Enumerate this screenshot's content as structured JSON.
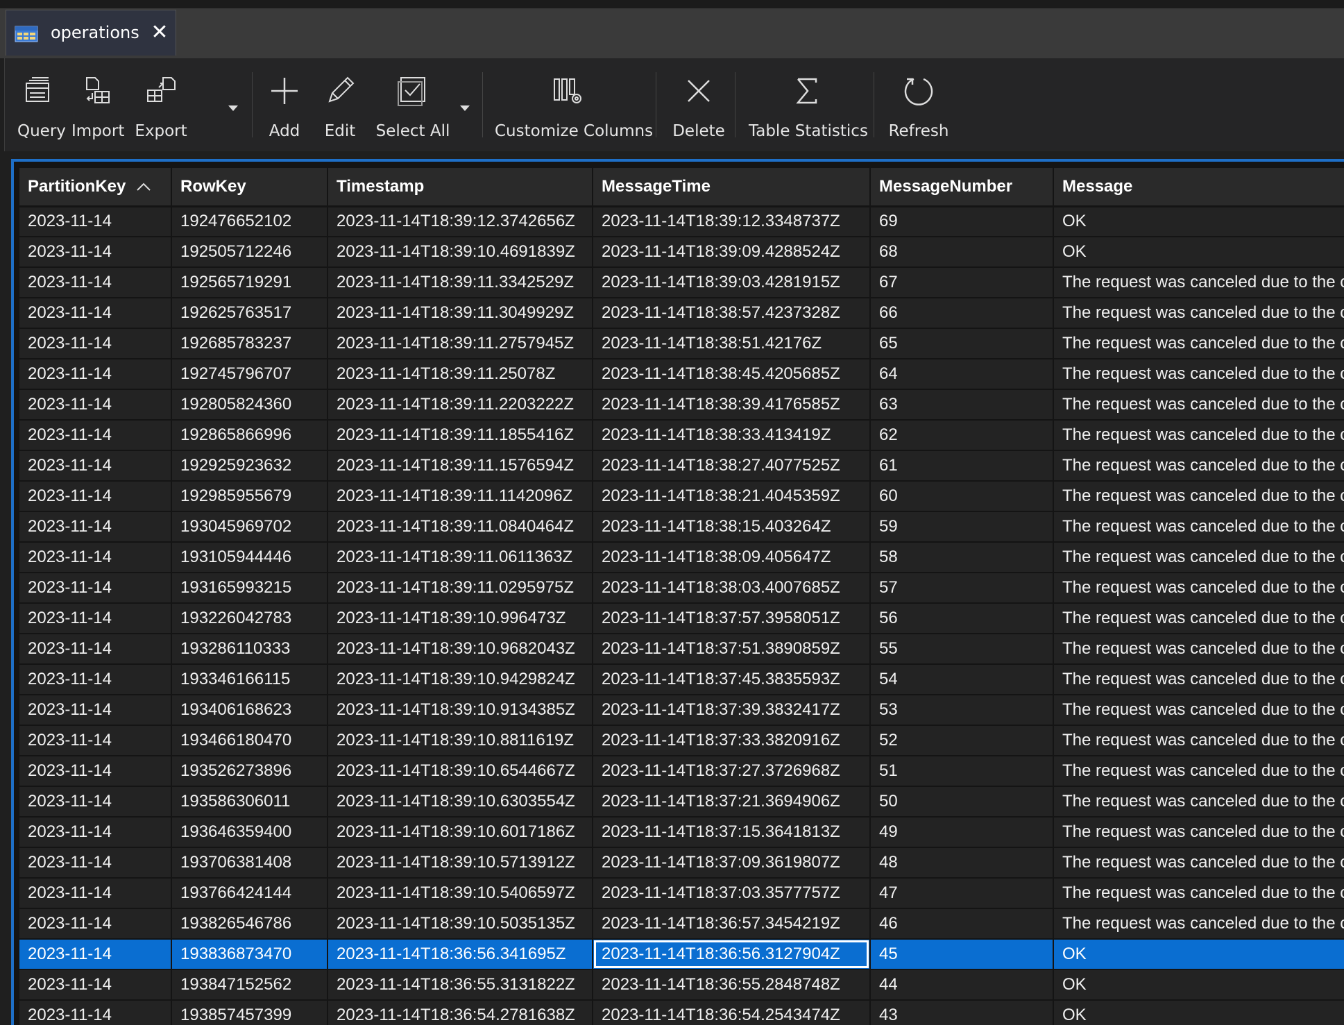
{
  "tab": {
    "label": "operations",
    "close": "✕"
  },
  "toolbar": {
    "buttons": [
      {
        "label": "Query"
      },
      {
        "label": "Import"
      },
      {
        "label": "Export"
      },
      {
        "label": "Add"
      },
      {
        "label": "Edit"
      },
      {
        "label": "Select All"
      },
      {
        "label": "Customize Columns"
      },
      {
        "label": "Delete"
      },
      {
        "label": "Table Statistics"
      },
      {
        "label": "Refresh"
      }
    ]
  },
  "table": {
    "columns": [
      "PartitionKey",
      "RowKey",
      "Timestamp",
      "MessageTime",
      "MessageNumber",
      "Message"
    ],
    "sort": {
      "column": "PartitionKey",
      "direction": "ascending"
    },
    "selected_row": 24,
    "rows": [
      [
        "2023-11-14",
        "192476652102",
        "2023-11-14T18:39:12.3742656Z",
        "2023-11-14T18:39:12.3348737Z",
        "69",
        "OK"
      ],
      [
        "2023-11-14",
        "192505712246",
        "2023-11-14T18:39:10.4691839Z",
        "2023-11-14T18:39:09.4288524Z",
        "68",
        "OK"
      ],
      [
        "2023-11-14",
        "192565719291",
        "2023-11-14T18:39:11.3342529Z",
        "2023-11-14T18:39:03.4281915Z",
        "67",
        "The request was canceled due to the c"
      ],
      [
        "2023-11-14",
        "192625763517",
        "2023-11-14T18:39:11.3049929Z",
        "2023-11-14T18:38:57.4237328Z",
        "66",
        "The request was canceled due to the c"
      ],
      [
        "2023-11-14",
        "192685783237",
        "2023-11-14T18:39:11.2757945Z",
        "2023-11-14T18:38:51.42176Z",
        "65",
        "The request was canceled due to the c"
      ],
      [
        "2023-11-14",
        "192745796707",
        "2023-11-14T18:39:11.25078Z",
        "2023-11-14T18:38:45.4205685Z",
        "64",
        "The request was canceled due to the c"
      ],
      [
        "2023-11-14",
        "192805824360",
        "2023-11-14T18:39:11.2203222Z",
        "2023-11-14T18:38:39.4176585Z",
        "63",
        "The request was canceled due to the c"
      ],
      [
        "2023-11-14",
        "192865866996",
        "2023-11-14T18:39:11.1855416Z",
        "2023-11-14T18:38:33.413419Z",
        "62",
        "The request was canceled due to the c"
      ],
      [
        "2023-11-14",
        "192925923632",
        "2023-11-14T18:39:11.1576594Z",
        "2023-11-14T18:38:27.4077525Z",
        "61",
        "The request was canceled due to the c"
      ],
      [
        "2023-11-14",
        "192985955679",
        "2023-11-14T18:39:11.1142096Z",
        "2023-11-14T18:38:21.4045359Z",
        "60",
        "The request was canceled due to the c"
      ],
      [
        "2023-11-14",
        "193045969702",
        "2023-11-14T18:39:11.0840464Z",
        "2023-11-14T18:38:15.403264Z",
        "59",
        "The request was canceled due to the c"
      ],
      [
        "2023-11-14",
        "193105944446",
        "2023-11-14T18:39:11.0611363Z",
        "2023-11-14T18:38:09.405647Z",
        "58",
        "The request was canceled due to the c"
      ],
      [
        "2023-11-14",
        "193165993215",
        "2023-11-14T18:39:11.0295975Z",
        "2023-11-14T18:38:03.4007685Z",
        "57",
        "The request was canceled due to the c"
      ],
      [
        "2023-11-14",
        "193226042783",
        "2023-11-14T18:39:10.996473Z",
        "2023-11-14T18:37:57.3958051Z",
        "56",
        "The request was canceled due to the c"
      ],
      [
        "2023-11-14",
        "193286110333",
        "2023-11-14T18:39:10.9682043Z",
        "2023-11-14T18:37:51.3890859Z",
        "55",
        "The request was canceled due to the c"
      ],
      [
        "2023-11-14",
        "193346166115",
        "2023-11-14T18:39:10.9429824Z",
        "2023-11-14T18:37:45.3835593Z",
        "54",
        "The request was canceled due to the c"
      ],
      [
        "2023-11-14",
        "193406168623",
        "2023-11-14T18:39:10.9134385Z",
        "2023-11-14T18:37:39.3832417Z",
        "53",
        "The request was canceled due to the c"
      ],
      [
        "2023-11-14",
        "193466180470",
        "2023-11-14T18:39:10.8811619Z",
        "2023-11-14T18:37:33.3820916Z",
        "52",
        "The request was canceled due to the c"
      ],
      [
        "2023-11-14",
        "193526273896",
        "2023-11-14T18:39:10.6544667Z",
        "2023-11-14T18:37:27.3726968Z",
        "51",
        "The request was canceled due to the c"
      ],
      [
        "2023-11-14",
        "193586306011",
        "2023-11-14T18:39:10.6303554Z",
        "2023-11-14T18:37:21.3694906Z",
        "50",
        "The request was canceled due to the c"
      ],
      [
        "2023-11-14",
        "193646359400",
        "2023-11-14T18:39:10.6017186Z",
        "2023-11-14T18:37:15.3641813Z",
        "49",
        "The request was canceled due to the c"
      ],
      [
        "2023-11-14",
        "193706381408",
        "2023-11-14T18:39:10.5713912Z",
        "2023-11-14T18:37:09.3619807Z",
        "48",
        "The request was canceled due to the c"
      ],
      [
        "2023-11-14",
        "193766424144",
        "2023-11-14T18:39:10.5406597Z",
        "2023-11-14T18:37:03.3577757Z",
        "47",
        "The request was canceled due to the c"
      ],
      [
        "2023-11-14",
        "193826546786",
        "2023-11-14T18:39:10.5035135Z",
        "2023-11-14T18:36:57.3454219Z",
        "46",
        "The request was canceled due to the c"
      ],
      [
        "2023-11-14",
        "193836873470",
        "2023-11-14T18:36:56.341695Z",
        "2023-11-14T18:36:56.3127904Z",
        "45",
        "OK"
      ],
      [
        "2023-11-14",
        "193847152562",
        "2023-11-14T18:36:55.3131822Z",
        "2023-11-14T18:36:55.2848748Z",
        "44",
        "OK"
      ],
      [
        "2023-11-14",
        "193857457399",
        "2023-11-14T18:36:54.2781638Z",
        "2023-11-14T18:36:54.2543474Z",
        "43",
        "OK"
      ]
    ]
  },
  "colors": {
    "accent": "#0a6ed1",
    "frame": "#1e6fc7",
    "background": "#1f1f1f"
  }
}
